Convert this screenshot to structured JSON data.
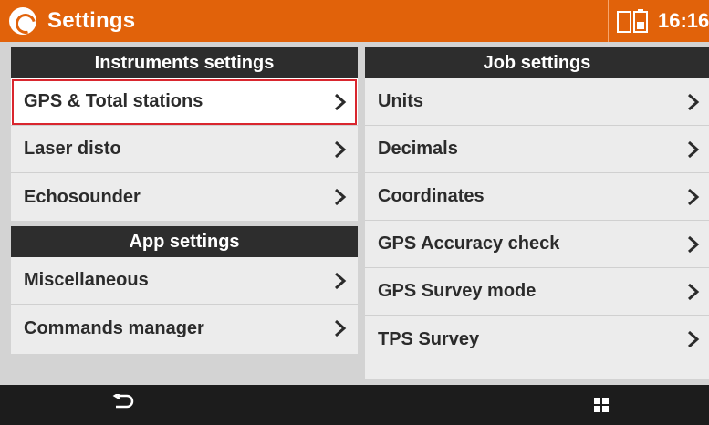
{
  "app": {
    "title": "Settings",
    "logo_icon": "app-logo-icon",
    "accent_color": "#e1620a"
  },
  "status_bar": {
    "time": "16:16",
    "battery_icon": "battery-icon"
  },
  "instruments_settings": {
    "header": "Instruments settings",
    "items": [
      {
        "label": "GPS & Total stations",
        "selected": true
      },
      {
        "label": "Laser disto"
      },
      {
        "label": "Echosounder"
      }
    ]
  },
  "app_settings": {
    "header": "App settings",
    "items": [
      {
        "label": "Miscellaneous"
      },
      {
        "label": "Commands manager"
      }
    ]
  },
  "job_settings": {
    "header": "Job settings",
    "items": [
      {
        "label": "Units"
      },
      {
        "label": "Decimals"
      },
      {
        "label": "Coordinates"
      },
      {
        "label": "GPS Accuracy check"
      },
      {
        "label": "GPS Survey mode"
      },
      {
        "label": "TPS Survey"
      }
    ]
  },
  "navbar": {
    "back_icon": "back-icon",
    "menu_icon": "grid-menu-icon"
  },
  "colors": {
    "selection_border": "#d9262e",
    "header_bg": "#2d2d2d"
  }
}
